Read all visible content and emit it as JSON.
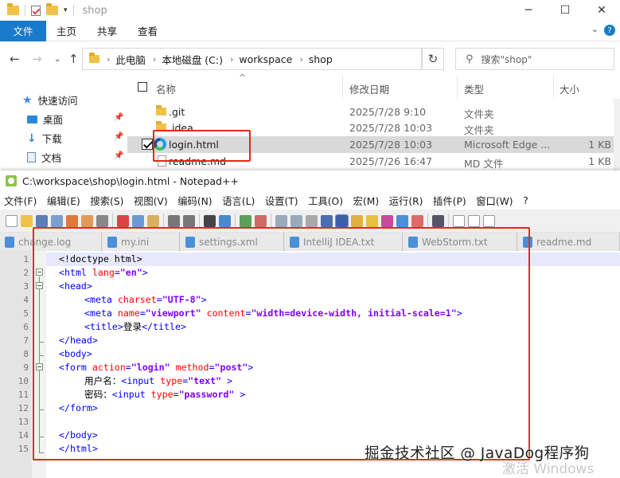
{
  "explorer": {
    "title": "shop",
    "ribbon": {
      "file": "文件",
      "home": "主页",
      "share": "共享",
      "view": "查看"
    },
    "breadcrumb": [
      "此电脑",
      "本地磁盘 (C:)",
      "workspace",
      "shop"
    ],
    "search_placeholder": "搜索\"shop\"",
    "nav": [
      {
        "label": "快速访问",
        "icon": "star-icon"
      },
      {
        "label": "桌面",
        "icon": "desktop-icon",
        "pinned": true
      },
      {
        "label": "下载",
        "icon": "download-icon",
        "pinned": true
      },
      {
        "label": "文档",
        "icon": "document-icon",
        "pinned": true
      }
    ],
    "columns": {
      "name": "名称",
      "modified": "修改日期",
      "type": "类型",
      "size": "大小"
    },
    "rows": [
      {
        "name": ".git",
        "date": "2025/7/28 9:10",
        "type": "文件夹",
        "size": "",
        "icon": "folder-icon"
      },
      {
        "name": ".idea",
        "date": "2025/7/28 10:03",
        "type": "文件夹",
        "size": "",
        "icon": "folder-icon"
      },
      {
        "name": "login.html",
        "date": "2025/7/28 10:03",
        "type": "Microsoft Edge ...",
        "size": "1 KB",
        "icon": "edge-icon",
        "selected": true
      },
      {
        "name": "readme.md",
        "date": "2025/7/26 16:47",
        "type": "MD 文件",
        "size": "1 KB",
        "icon": "md-file-icon"
      }
    ]
  },
  "notepad": {
    "title": "C:\\workspace\\shop\\login.html - Notepad++",
    "menu": [
      "文件(F)",
      "编辑(E)",
      "搜索(S)",
      "视图(V)",
      "编码(N)",
      "语言(L)",
      "设置(T)",
      "工具(O)",
      "宏(M)",
      "运行(R)",
      "插件(P)",
      "窗口(W)",
      "?"
    ],
    "tabs": [
      "change.log",
      "my.ini",
      "settings.xml",
      "IntelliJ IDEA.txt",
      "WebStorm.txt",
      "readme.md"
    ],
    "line_numbers": [
      "1",
      "2",
      "3",
      "4",
      "5",
      "6",
      "7",
      "8",
      "9",
      "10",
      "11",
      "12",
      "13",
      "14",
      "15"
    ],
    "code": {
      "l1": "<!doctype html>",
      "l2a": "<html ",
      "l2b": "lang",
      "l2c": "=",
      "l2d": "\"en\"",
      "l2e": ">",
      "l3": "<head>",
      "l4a": "<meta ",
      "l4b": "charset",
      "l4c": "=",
      "l4d": "\"UTF-8\"",
      "l4e": ">",
      "l5a": "<meta ",
      "l5b": "name",
      "l5c": "=",
      "l5d": "\"viewport\"",
      "l5e": " content",
      "l5f": "=",
      "l5g": "\"width=device-width, initial-scale=1\"",
      "l5h": ">",
      "l6a": "<title>",
      "l6b": "登录",
      "l6c": "</title>",
      "l7": "</head>",
      "l8": "<body>",
      "l9a": "<form ",
      "l9b": "action",
      "l9c": "=",
      "l9d": "\"login\"",
      "l9e": " method",
      "l9f": "=",
      "l9g": "\"post\"",
      "l9h": ">",
      "l10a": "用户名：",
      "l10b": "<input ",
      "l10c": "type",
      "l10d": "=",
      "l10e": "\"text\"",
      "l10f": " >",
      "l11a": "密码：",
      "l11b": "<input ",
      "l11c": "type",
      "l11d": "=",
      "l11e": "\"password\"",
      "l11f": " >",
      "l12": "</form>",
      "l14": "</body>",
      "l15": "</html>"
    }
  },
  "watermark": "掘金技术社区 @ JavaDog程序狗",
  "activation": "激活 Windows",
  "colors": {
    "tag": "#0000ff",
    "attr": "#ff0000",
    "value": "#8000ff",
    "highlight": "#e8281a",
    "ribbon_file": "#1979ca"
  }
}
